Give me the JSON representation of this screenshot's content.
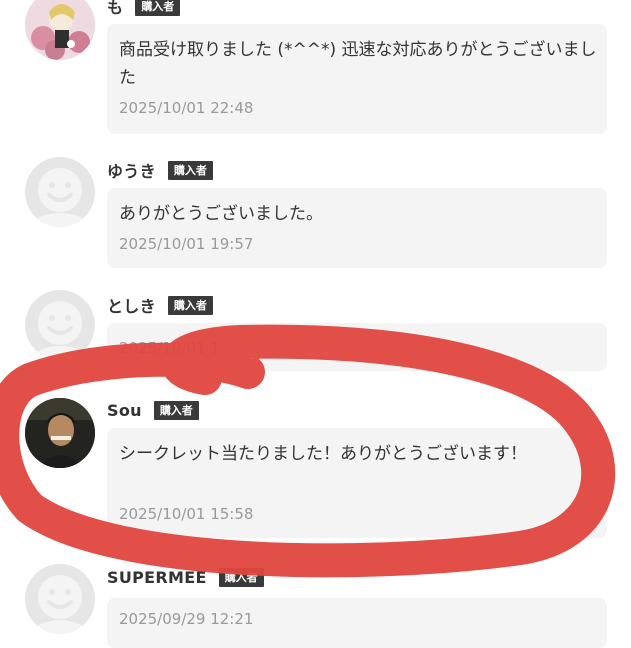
{
  "comments": [
    {
      "name": "も",
      "badge": "購入者",
      "message": "商品受け取りました (*^^*) 迅速な対応ありがとうございました",
      "timestamp": "2025/10/01 22:48",
      "avatar": "illustration-avatar"
    },
    {
      "name": "ゆうき",
      "badge": "購入者",
      "message": "ありがとうございました。",
      "timestamp": "2025/10/01 19:57",
      "avatar": "default-avatar"
    },
    {
      "name": "としき",
      "badge": "購入者",
      "message": "",
      "timestamp": "2025/10/01 1",
      "avatar": "default-avatar"
    },
    {
      "name": "Sou",
      "badge": "購入者",
      "message": "シークレット当たりました！ありがとうございます！",
      "timestamp": "2025/10/01 15:58",
      "avatar": "photo-avatar"
    },
    {
      "name": "SUPERMEE",
      "badge": "購入者",
      "message": "",
      "timestamp": "2025/09/29 12:21",
      "avatar": "default-avatar"
    }
  ],
  "colors": {
    "badge_bg": "#3a3a3a",
    "bubble_bg": "#f4f4f5",
    "timestamp": "#999999",
    "highlight_marker": "#e0463f"
  }
}
